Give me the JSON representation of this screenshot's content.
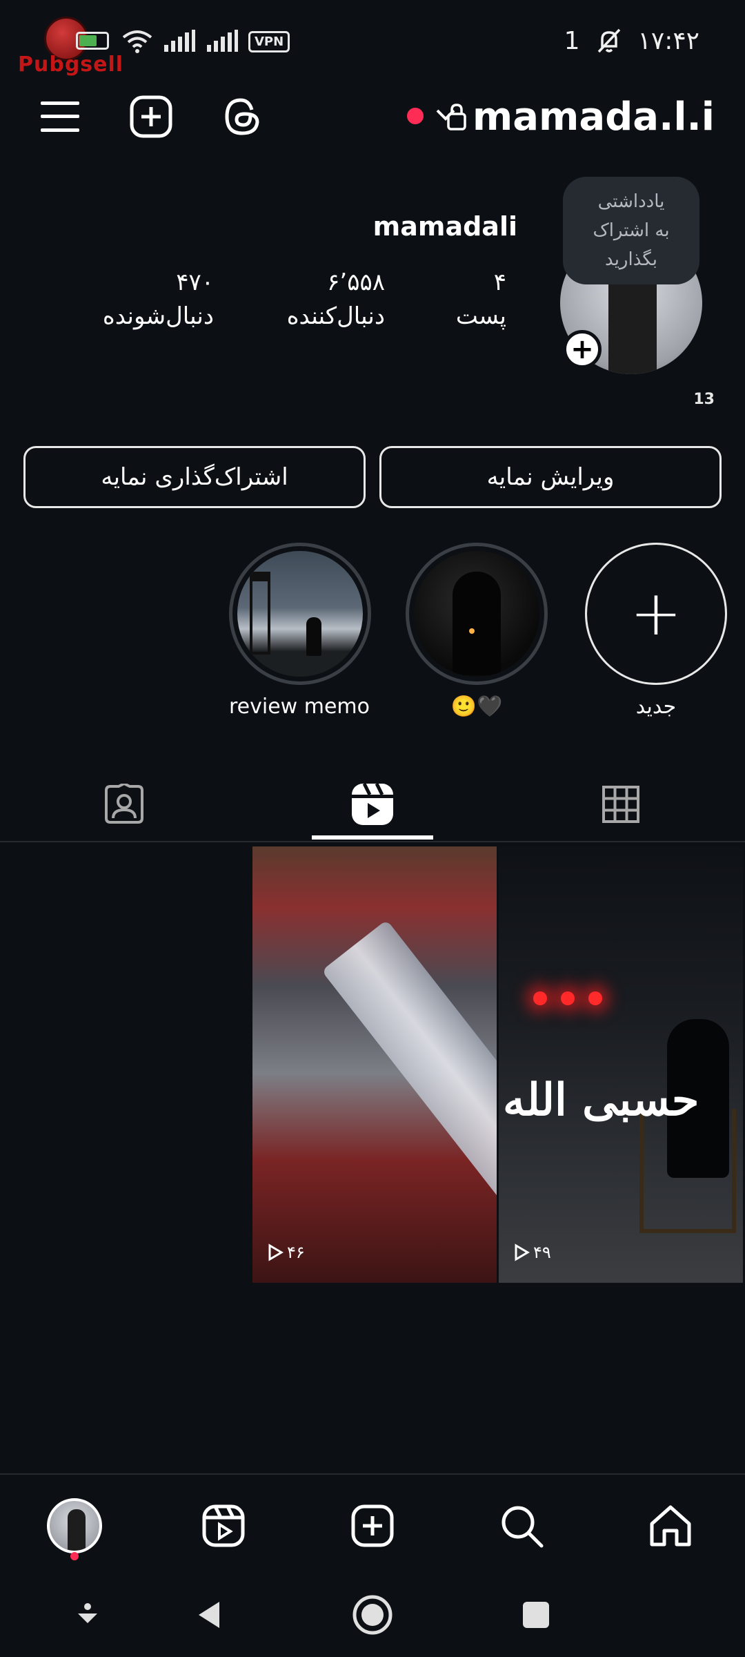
{
  "status_bar": {
    "time": "۱۷:۴۲",
    "battery": "00",
    "vpn": "VPN",
    "network": "1",
    "logo_text": "Pubgsell"
  },
  "header": {
    "username": "mamada.l.i",
    "live_dot_color": "#ff2d55"
  },
  "profile": {
    "display_name": "mamadali",
    "note_lines": [
      "یادداشتی",
      "به اشتراک",
      "بگذارید"
    ],
    "note_count": "13",
    "stats": {
      "posts": {
        "value": "۴",
        "label": "پست"
      },
      "followers": {
        "value": "۶٬۵۵۸",
        "label": "دنبال‌کننده"
      },
      "following": {
        "value": "۴۷۰",
        "label": "دنبال‌شونده"
      }
    },
    "edit_button": "ویرایش نمایه",
    "share_button": "اشتراک‌گذاری نمایه"
  },
  "highlights": [
    {
      "label": "جدید",
      "icon": "plus-icon"
    },
    {
      "label": "🙂🖤"
    },
    {
      "label": "review memori..."
    }
  ],
  "tabs": [
    {
      "name": "grid",
      "icon": "grid-icon"
    },
    {
      "name": "reels",
      "icon": "reels-icon",
      "active": true
    },
    {
      "name": "tagged",
      "icon": "tagged-icon"
    }
  ],
  "reels": [
    {
      "views": "۴۶"
    },
    {
      "views": "۴۹",
      "overlay_text": "حسبی الله"
    }
  ],
  "bottom_nav": [
    {
      "name": "home",
      "icon": "home-icon"
    },
    {
      "name": "search",
      "icon": "search-icon"
    },
    {
      "name": "create",
      "icon": "plus-square-icon"
    },
    {
      "name": "reels",
      "icon": "reels-icon"
    },
    {
      "name": "profile",
      "icon": "avatar"
    }
  ],
  "colors": {
    "background": "#0c1014",
    "accent_red": "#ff2d55",
    "note_bubble": "#262a31"
  }
}
